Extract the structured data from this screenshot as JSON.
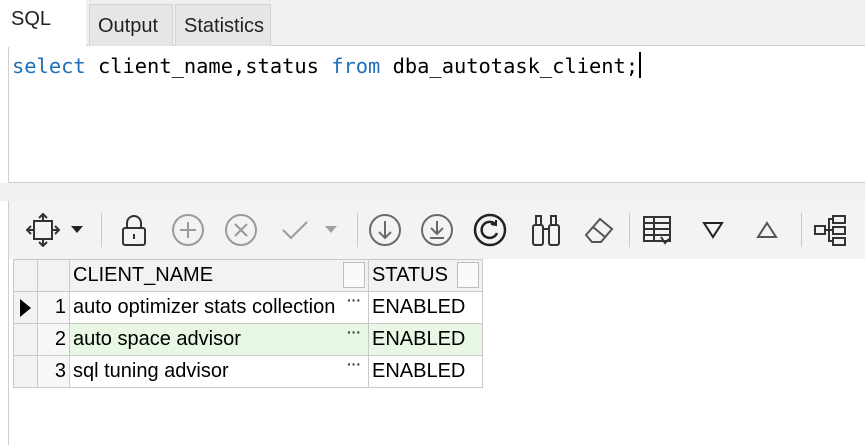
{
  "tabs": [
    {
      "label": "SQL",
      "active": true
    },
    {
      "label": "Output",
      "active": false
    },
    {
      "label": "Statistics",
      "active": false
    }
  ],
  "editor": {
    "kw_select": "select",
    "part1": " client_name,status ",
    "kw_from": "from",
    "part2": " dba_autotask_client;"
  },
  "toolbar": {
    "icons": [
      "freeze-icon",
      "dropdown-arrow-icon",
      "lock-icon",
      "add-icon",
      "delete-icon",
      "confirm-icon",
      "confirm-dropdown-icon",
      "fetch-next-icon",
      "fetch-all-icon",
      "refresh-icon",
      "find-icon",
      "clear-icon",
      "grid-view-icon",
      "sort-descending-icon",
      "sort-ascending-icon",
      "tree-icon"
    ]
  },
  "grid": {
    "columns": [
      "CLIENT_NAME",
      "STATUS"
    ],
    "rows": [
      {
        "num": "1",
        "client_name": "auto optimizer stats collection",
        "status": "ENABLED"
      },
      {
        "num": "2",
        "client_name": "auto space advisor",
        "status": "ENABLED"
      },
      {
        "num": "3",
        "client_name": "sql tuning advisor",
        "status": "ENABLED"
      }
    ],
    "ellipsis": "···"
  },
  "colors": {
    "keyword": "#1f6fb8",
    "selected_row": "#e8f8e4"
  }
}
